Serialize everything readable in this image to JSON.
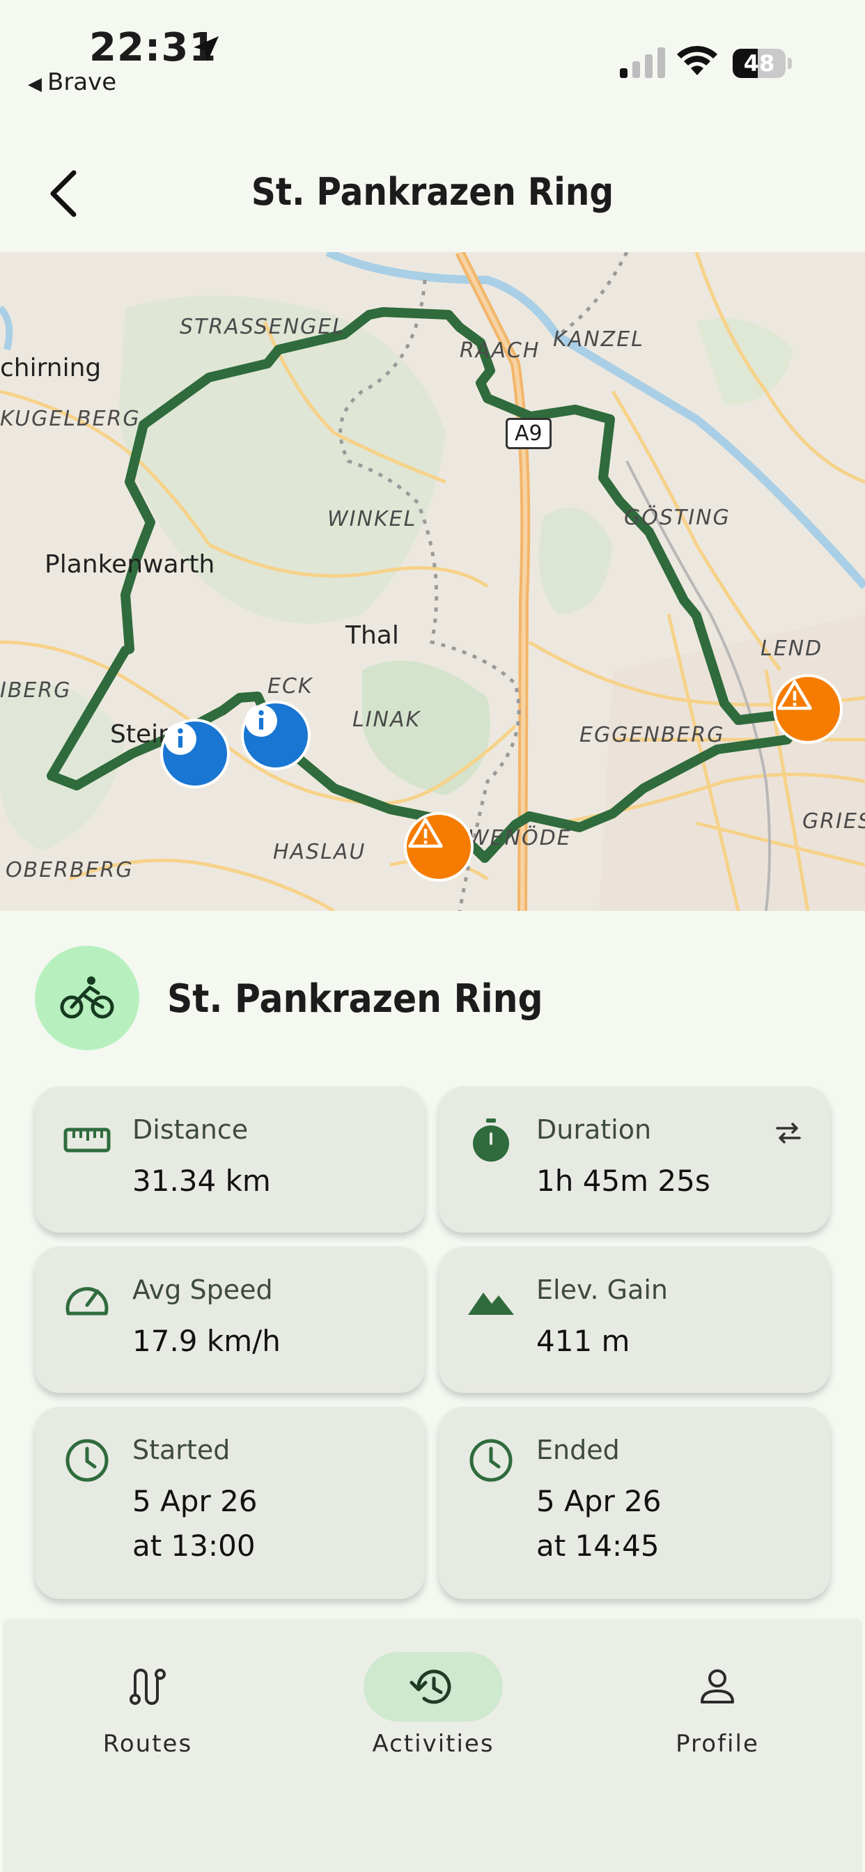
{
  "status_bar": {
    "time": "22:31",
    "back_app": "Brave",
    "battery": "48",
    "battery_pct": 48
  },
  "header": {
    "title": "St. Pankrazen Ring"
  },
  "map": {
    "labels": [
      "STRASSENGEL",
      "RAACH",
      "KANZEL",
      "chirning",
      "KUGELBERG",
      "WINKEL",
      "GÖSTING",
      "Plankenwarth",
      "Thal",
      "LEND",
      "IBERG",
      "ECK",
      "LINAK",
      "EGGENBERG",
      "Stein",
      "HASLAU",
      "WENÖDE",
      "OBERBERG",
      "GRIES"
    ],
    "road_shield": "A9",
    "markers": [
      {
        "type": "info",
        "icon": "info-icon"
      },
      {
        "type": "info",
        "icon": "info-icon"
      },
      {
        "type": "warning",
        "icon": "warning-icon"
      },
      {
        "type": "warning",
        "icon": "warning-icon"
      }
    ],
    "route_color": "#2f6b3c"
  },
  "activity": {
    "title": "St. Pankrazen Ring",
    "icon": "bicycle-icon"
  },
  "stats": {
    "distance": {
      "label": "Distance",
      "value": "31.34 km",
      "icon": "ruler-icon"
    },
    "duration": {
      "label": "Duration",
      "value": "1h 45m 25s",
      "icon": "stopwatch-icon"
    },
    "avg_speed": {
      "label": "Avg Speed",
      "value": "17.9 km/h",
      "icon": "speedometer-icon"
    },
    "elev_gain": {
      "label": "Elev. Gain",
      "value": "411 m",
      "icon": "mountain-icon"
    },
    "started": {
      "label": "Started",
      "date": "5 Apr 26",
      "time": "at 13:00",
      "icon": "clock-icon"
    },
    "ended": {
      "label": "Ended",
      "date": "5 Apr 26",
      "time": "at 14:45",
      "icon": "clock-icon"
    }
  },
  "bottom_nav": {
    "items": [
      {
        "label": "Routes",
        "icon": "route-icon",
        "active": false
      },
      {
        "label": "Activities",
        "icon": "history-icon",
        "active": true
      },
      {
        "label": "Profile",
        "icon": "person-icon",
        "active": false
      }
    ]
  },
  "colors": {
    "accent": "#2f6b3c",
    "background": "#f4f8f1",
    "card": "#e7eae3",
    "active_pill": "#cfe9cf",
    "avatar_bg": "#b7f0be"
  }
}
